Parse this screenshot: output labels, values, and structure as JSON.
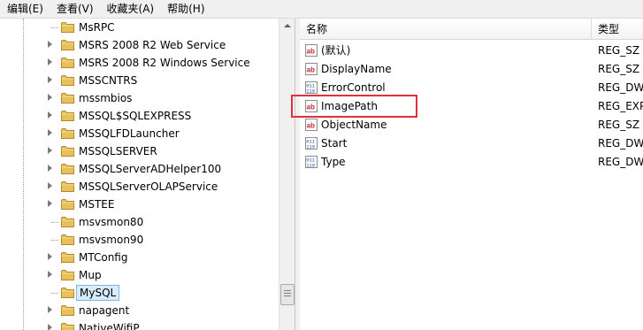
{
  "menu": [
    "编辑(E)",
    "查看(V)",
    "收藏夹(A)",
    "帮助(H)"
  ],
  "tree": {
    "items": [
      {
        "label": "MsRPC",
        "expandable": false
      },
      {
        "label": "MSRS 2008 R2 Web Service",
        "expandable": true
      },
      {
        "label": "MSRS 2008 R2 Windows Service",
        "expandable": true
      },
      {
        "label": "MSSCNTRS",
        "expandable": true
      },
      {
        "label": "mssmbios",
        "expandable": true
      },
      {
        "label": "MSSQL$SQLEXPRESS",
        "expandable": true
      },
      {
        "label": "MSSQLFDLauncher",
        "expandable": true
      },
      {
        "label": "MSSQLSERVER",
        "expandable": true
      },
      {
        "label": "MSSQLServerADHelper100",
        "expandable": true
      },
      {
        "label": "MSSQLServerOLAPService",
        "expandable": true
      },
      {
        "label": "MSTEE",
        "expandable": true
      },
      {
        "label": "msvsmon80",
        "expandable": false
      },
      {
        "label": "msvsmon90",
        "expandable": false
      },
      {
        "label": "MTConfig",
        "expandable": true
      },
      {
        "label": "Mup",
        "expandable": true
      },
      {
        "label": "MySQL",
        "expandable": false,
        "selected": true
      },
      {
        "label": "napagent",
        "expandable": true
      },
      {
        "label": "NativeWifiP",
        "expandable": true
      }
    ]
  },
  "values": {
    "header_name": "名称",
    "header_type": "类型",
    "rows": [
      {
        "name": "(默认)",
        "type": "REG_SZ",
        "icon": "string-value-icon"
      },
      {
        "name": "DisplayName",
        "type": "REG_SZ",
        "icon": "string-value-icon"
      },
      {
        "name": "ErrorControl",
        "type": "REG_DWORD",
        "icon": "binary-value-icon"
      },
      {
        "name": "ImagePath",
        "type": "REG_EXPAND_SZ",
        "icon": "string-value-icon"
      },
      {
        "name": "ObjectName",
        "type": "REG_SZ",
        "icon": "string-value-icon"
      },
      {
        "name": "Start",
        "type": "REG_DWORD",
        "icon": "binary-value-icon"
      },
      {
        "name": "Type",
        "type": "REG_DWORD",
        "icon": "binary-value-icon"
      }
    ]
  },
  "colors": {
    "highlight_box": "#e0313a",
    "selection_bg": "#d9ecfb",
    "folder": "#e8c15a"
  }
}
